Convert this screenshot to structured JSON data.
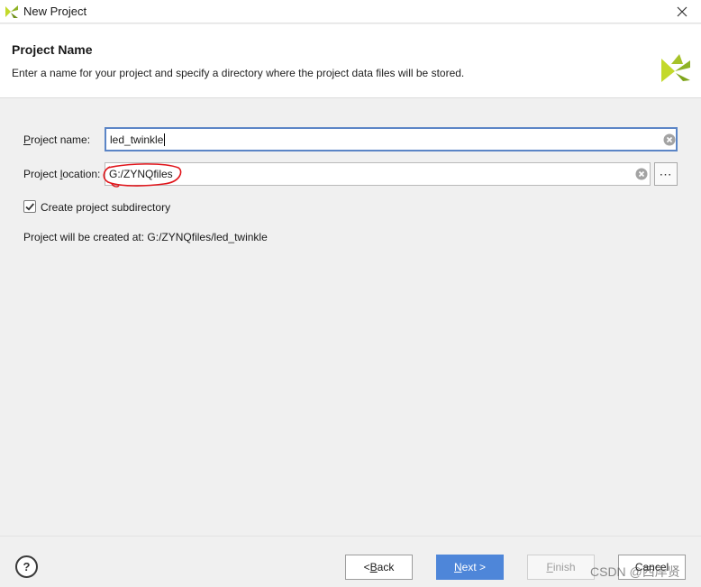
{
  "window": {
    "title": "New Project",
    "app_icon": "vivado-logo-icon",
    "close_icon": "close-icon"
  },
  "header": {
    "title": "Project Name",
    "description": "Enter a name for your project and specify a directory where the project data files will be stored.",
    "logo": "vivado-logo-icon"
  },
  "form": {
    "project_name": {
      "label_mnemonic": "P",
      "label_rest": "roject name:",
      "value": "led_twinkle"
    },
    "project_location": {
      "label_before": "Project ",
      "label_mnemonic": "l",
      "label_after": "ocation:",
      "value": "G:/ZYNQfiles",
      "browse_label": "⋯"
    },
    "create_subdirectory": {
      "label": "Create project subdirectory",
      "checked": true
    },
    "created_at": "Project will be created at: G:/ZYNQfiles/led_twinkle"
  },
  "footer": {
    "help_label": "?",
    "back": {
      "prefix": "< ",
      "mnemonic": "B",
      "rest": "ack"
    },
    "next": {
      "mnemonic": "N",
      "rest": "ext >"
    },
    "finish": {
      "mnemonic": "F",
      "rest": "inish"
    },
    "cancel": {
      "label": "Cancel"
    }
  },
  "watermark": "CSDN @西岸贤",
  "colors": {
    "accent": "#4e86d9",
    "focus_border": "#5b85c6",
    "annotation_red": "#e0141a",
    "logo_green_light": "#c3d92b",
    "logo_green_dark": "#7fa51c"
  }
}
